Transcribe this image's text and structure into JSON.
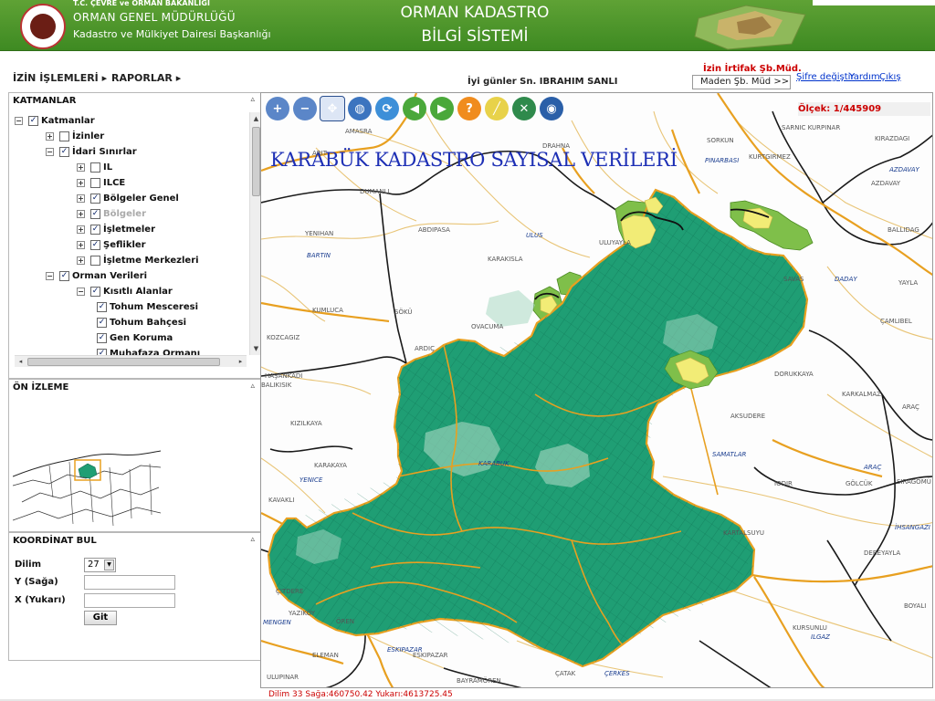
{
  "header": {
    "org_line1": "T.C. ÇEVRE ve ORMAN BAKANLIĞI",
    "org_line2": "ORMAN GENEL MÜDÜRLÜĞÜ",
    "org_line3": "Kadastro ve Mülkiyet Dairesi Başkanlığı",
    "app_line1": "ORMAN KADASTRO",
    "app_line2": "BİLGİ SİSTEMİ"
  },
  "nav": {
    "izin": "İZİN İŞLEMLERİ ▸",
    "raporlar": "RAPORLAR ▸",
    "greeting": "İyi günler Sn. IBRAHIM SANLI",
    "office_title": "İzin İrtifak Şb.Müd.",
    "office_select": "Maden Şb. Müd >>",
    "change_password": "Şifre değiştir",
    "help": "Yardım",
    "exit": "Çıkış"
  },
  "layers_panel": {
    "title": "KATMANLAR",
    "collapse": "▵",
    "scroll_up": "▲",
    "scroll_down": "▼",
    "scroll_left": "◂",
    "scroll_right": "▸",
    "scroll_grip": "≡",
    "items": [
      {
        "label": "Katmanlar",
        "toggle": "−",
        "checked": true
      },
      {
        "label": "İzinler",
        "toggle": "+",
        "checked": false
      },
      {
        "label": "İdari Sınırlar",
        "toggle": "−",
        "checked": true
      },
      {
        "label": "IL",
        "toggle": "+",
        "checked": false
      },
      {
        "label": "ILCE",
        "toggle": "+",
        "checked": false
      },
      {
        "label": "Bölgeler Genel",
        "toggle": "+",
        "checked": true
      },
      {
        "label": "Bölgeler",
        "toggle": "+",
        "checked": true,
        "disabled": true
      },
      {
        "label": "İşletmeler",
        "toggle": "+",
        "checked": true
      },
      {
        "label": "Şeflikler",
        "toggle": "+",
        "checked": true
      },
      {
        "label": "İşletme Merkezleri",
        "toggle": "+",
        "checked": false
      },
      {
        "label": "Orman Verileri",
        "toggle": "−",
        "checked": true
      },
      {
        "label": "Kısıtlı Alanlar",
        "toggle": "−",
        "checked": true
      },
      {
        "label": "Tohum Mesceresi",
        "checked": true
      },
      {
        "label": "Tohum Bahçesi",
        "checked": true
      },
      {
        "label": "Gen Koruma",
        "checked": true
      },
      {
        "label": "Muhafaza Ormanı",
        "checked": true
      }
    ]
  },
  "preview_panel": {
    "title": "ÖN İZLEME",
    "collapse": "▵"
  },
  "coord_panel": {
    "title": "KOORDİNAT BUL",
    "collapse": "▵",
    "zone_label": "Dilim",
    "zone_value": "27",
    "zone_arrow": "▼",
    "y_label": "Y (Sağa)",
    "x_label": "X (Yukarı)",
    "go_label": "Git"
  },
  "map": {
    "title": "KARABÜK KADASTRO SAYISAL VERİLERİ",
    "scale": "Ölçek: 1/445909",
    "coord_readout": "Dilim 33 Sağa:460750.42 Yukarı:4613725.45",
    "tools": [
      {
        "name": "zoom-in-icon",
        "glyph": "+",
        "color": "#5b86c8"
      },
      {
        "name": "zoom-out-icon",
        "glyph": "−",
        "color": "#5b86c8"
      },
      {
        "name": "pan-icon",
        "glyph": "✥",
        "color": "#2b62c4"
      },
      {
        "name": "globe-icon",
        "glyph": "◍",
        "color": "#3c74bf"
      },
      {
        "name": "refresh-icon",
        "glyph": "⟳",
        "color": "#3d8fd8"
      },
      {
        "name": "back-icon",
        "glyph": "◀",
        "color": "#4aa83a"
      },
      {
        "name": "forward-icon",
        "glyph": "▶",
        "color": "#4aa83a"
      },
      {
        "name": "help-icon",
        "glyph": "?",
        "color": "#f08c1e"
      },
      {
        "name": "measure-icon",
        "glyph": "╱",
        "color": "#e8d24a"
      },
      {
        "name": "tools-icon",
        "glyph": "✕",
        "color": "#2f8a4c"
      },
      {
        "name": "earth-icon",
        "glyph": "◉",
        "color": "#2a5fa8"
      }
    ],
    "places": [
      {
        "t": "AMASRA",
        "b": false
      },
      {
        "t": "DRAHNA",
        "b": false
      },
      {
        "t": "SORKUN",
        "b": false
      },
      {
        "t": "SARNIC KURPINAR",
        "b": false
      },
      {
        "t": "KIRAZDAGI",
        "b": false
      },
      {
        "t": "ARIT",
        "b": false
      },
      {
        "t": "PINARBASI",
        "b": true
      },
      {
        "t": "KURTGIRMEZ",
        "b": false
      },
      {
        "t": "AZDAVAY",
        "b": true
      },
      {
        "t": "AZDAVAY",
        "b": false
      },
      {
        "t": "DUMANLI",
        "b": false
      },
      {
        "t": "YENIHAN",
        "b": false
      },
      {
        "t": "ABDIPASA",
        "b": false
      },
      {
        "t": "ULUS",
        "b": true
      },
      {
        "t": "ULUYAYLA",
        "b": false
      },
      {
        "t": "BALLIDAG",
        "b": false
      },
      {
        "t": "BARTIN",
        "b": true
      },
      {
        "t": "KARAKISLA",
        "b": false
      },
      {
        "t": "SAVAS",
        "b": false
      },
      {
        "t": "DADAY",
        "b": true
      },
      {
        "t": "YAYLA",
        "b": false
      },
      {
        "t": "KUMLUCA",
        "b": false
      },
      {
        "t": "SÖKÜ",
        "b": false
      },
      {
        "t": "ÇAMLIBEL",
        "b": false
      },
      {
        "t": "OVACUMA",
        "b": false
      },
      {
        "t": "KOZCAGIZ",
        "b": false
      },
      {
        "t": "ARDIÇ",
        "b": false
      },
      {
        "t": "DORUKKAYA",
        "b": false
      },
      {
        "t": "HAŞANKADI",
        "b": false
      },
      {
        "t": "KARKALMAZ",
        "b": false
      },
      {
        "t": "ARAÇ",
        "b": false
      },
      {
        "t": "BALIKISIK",
        "b": false
      },
      {
        "t": "AKSUDERE",
        "b": false
      },
      {
        "t": "KIZILKAYA",
        "b": false
      },
      {
        "t": "SAMATLAR",
        "b": true
      },
      {
        "t": "KARABUK",
        "b": true
      },
      {
        "t": "ARAÇ",
        "b": true
      },
      {
        "t": "KARAKAYA",
        "b": false
      },
      {
        "t": "IODIR",
        "b": false
      },
      {
        "t": "GÖLCÜK",
        "b": false
      },
      {
        "t": "SIRAGÖMÜ",
        "b": false
      },
      {
        "t": "YENICE",
        "b": true
      },
      {
        "t": "KAVAKLI",
        "b": false
      },
      {
        "t": "İHSANGAZI",
        "b": true
      },
      {
        "t": "KARTALSUYU",
        "b": false
      },
      {
        "t": "DEREYAYLA",
        "b": false
      },
      {
        "t": "ÇITDERE",
        "b": false
      },
      {
        "t": "YAZIKÖY",
        "b": false
      },
      {
        "t": "MENGEN",
        "b": true
      },
      {
        "t": "ÖREN",
        "b": false
      },
      {
        "t": "BOYALI",
        "b": false
      },
      {
        "t": "KURSUNLU",
        "b": false
      },
      {
        "t": "ILGAZ",
        "b": true
      },
      {
        "t": "ELEMAN",
        "b": false
      },
      {
        "t": "ESKIPAZAR",
        "b": true
      },
      {
        "t": "ESKIPAZAR",
        "b": false
      },
      {
        "t": "ÇATAK",
        "b": false
      },
      {
        "t": "ÇERKES",
        "b": true
      },
      {
        "t": "ULUPINAR",
        "b": false
      },
      {
        "t": "BAYRAMÖREN",
        "b": false
      }
    ]
  },
  "colors": {
    "header_green": "#4a9429",
    "forest_green": "#1f9e74",
    "light_green": "#7fbf4a",
    "yellow_patch": "#f2ec76",
    "boundary_orange": "#e8a020",
    "title_blue": "#1d2fb5",
    "scale_red": "#cc0000"
  }
}
